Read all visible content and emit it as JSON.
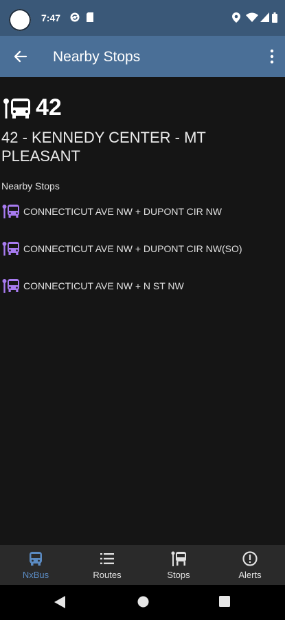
{
  "status_bar": {
    "time": "7:47"
  },
  "app_bar": {
    "title": "Nearby Stops"
  },
  "route": {
    "number": "42",
    "name": "42 - KENNEDY CENTER  - MT PLEASANT"
  },
  "section": {
    "label": "Nearby Stops"
  },
  "stops": [
    {
      "name": "CONNECTICUT AVE NW + DUPONT CIR NW"
    },
    {
      "name": "CONNECTICUT AVE NW + DUPONT CIR NW(SO)"
    },
    {
      "name": "CONNECTICUT AVE NW + N ST NW"
    }
  ],
  "bottom_nav": {
    "items": [
      {
        "label": "NxBus",
        "icon": "bus-icon",
        "active": true
      },
      {
        "label": "Routes",
        "icon": "list-icon",
        "active": false
      },
      {
        "label": "Stops",
        "icon": "bus-stop-icon",
        "active": false
      },
      {
        "label": "Alerts",
        "icon": "alert-icon",
        "active": false
      }
    ]
  },
  "colors": {
    "status_bar": "#3a5878",
    "app_bar": "#4a6f97",
    "background": "#151515",
    "stop_icon": "#a77bf0",
    "nav_active": "#5b8bc2",
    "bottom_nav": "#2a2a2a"
  }
}
